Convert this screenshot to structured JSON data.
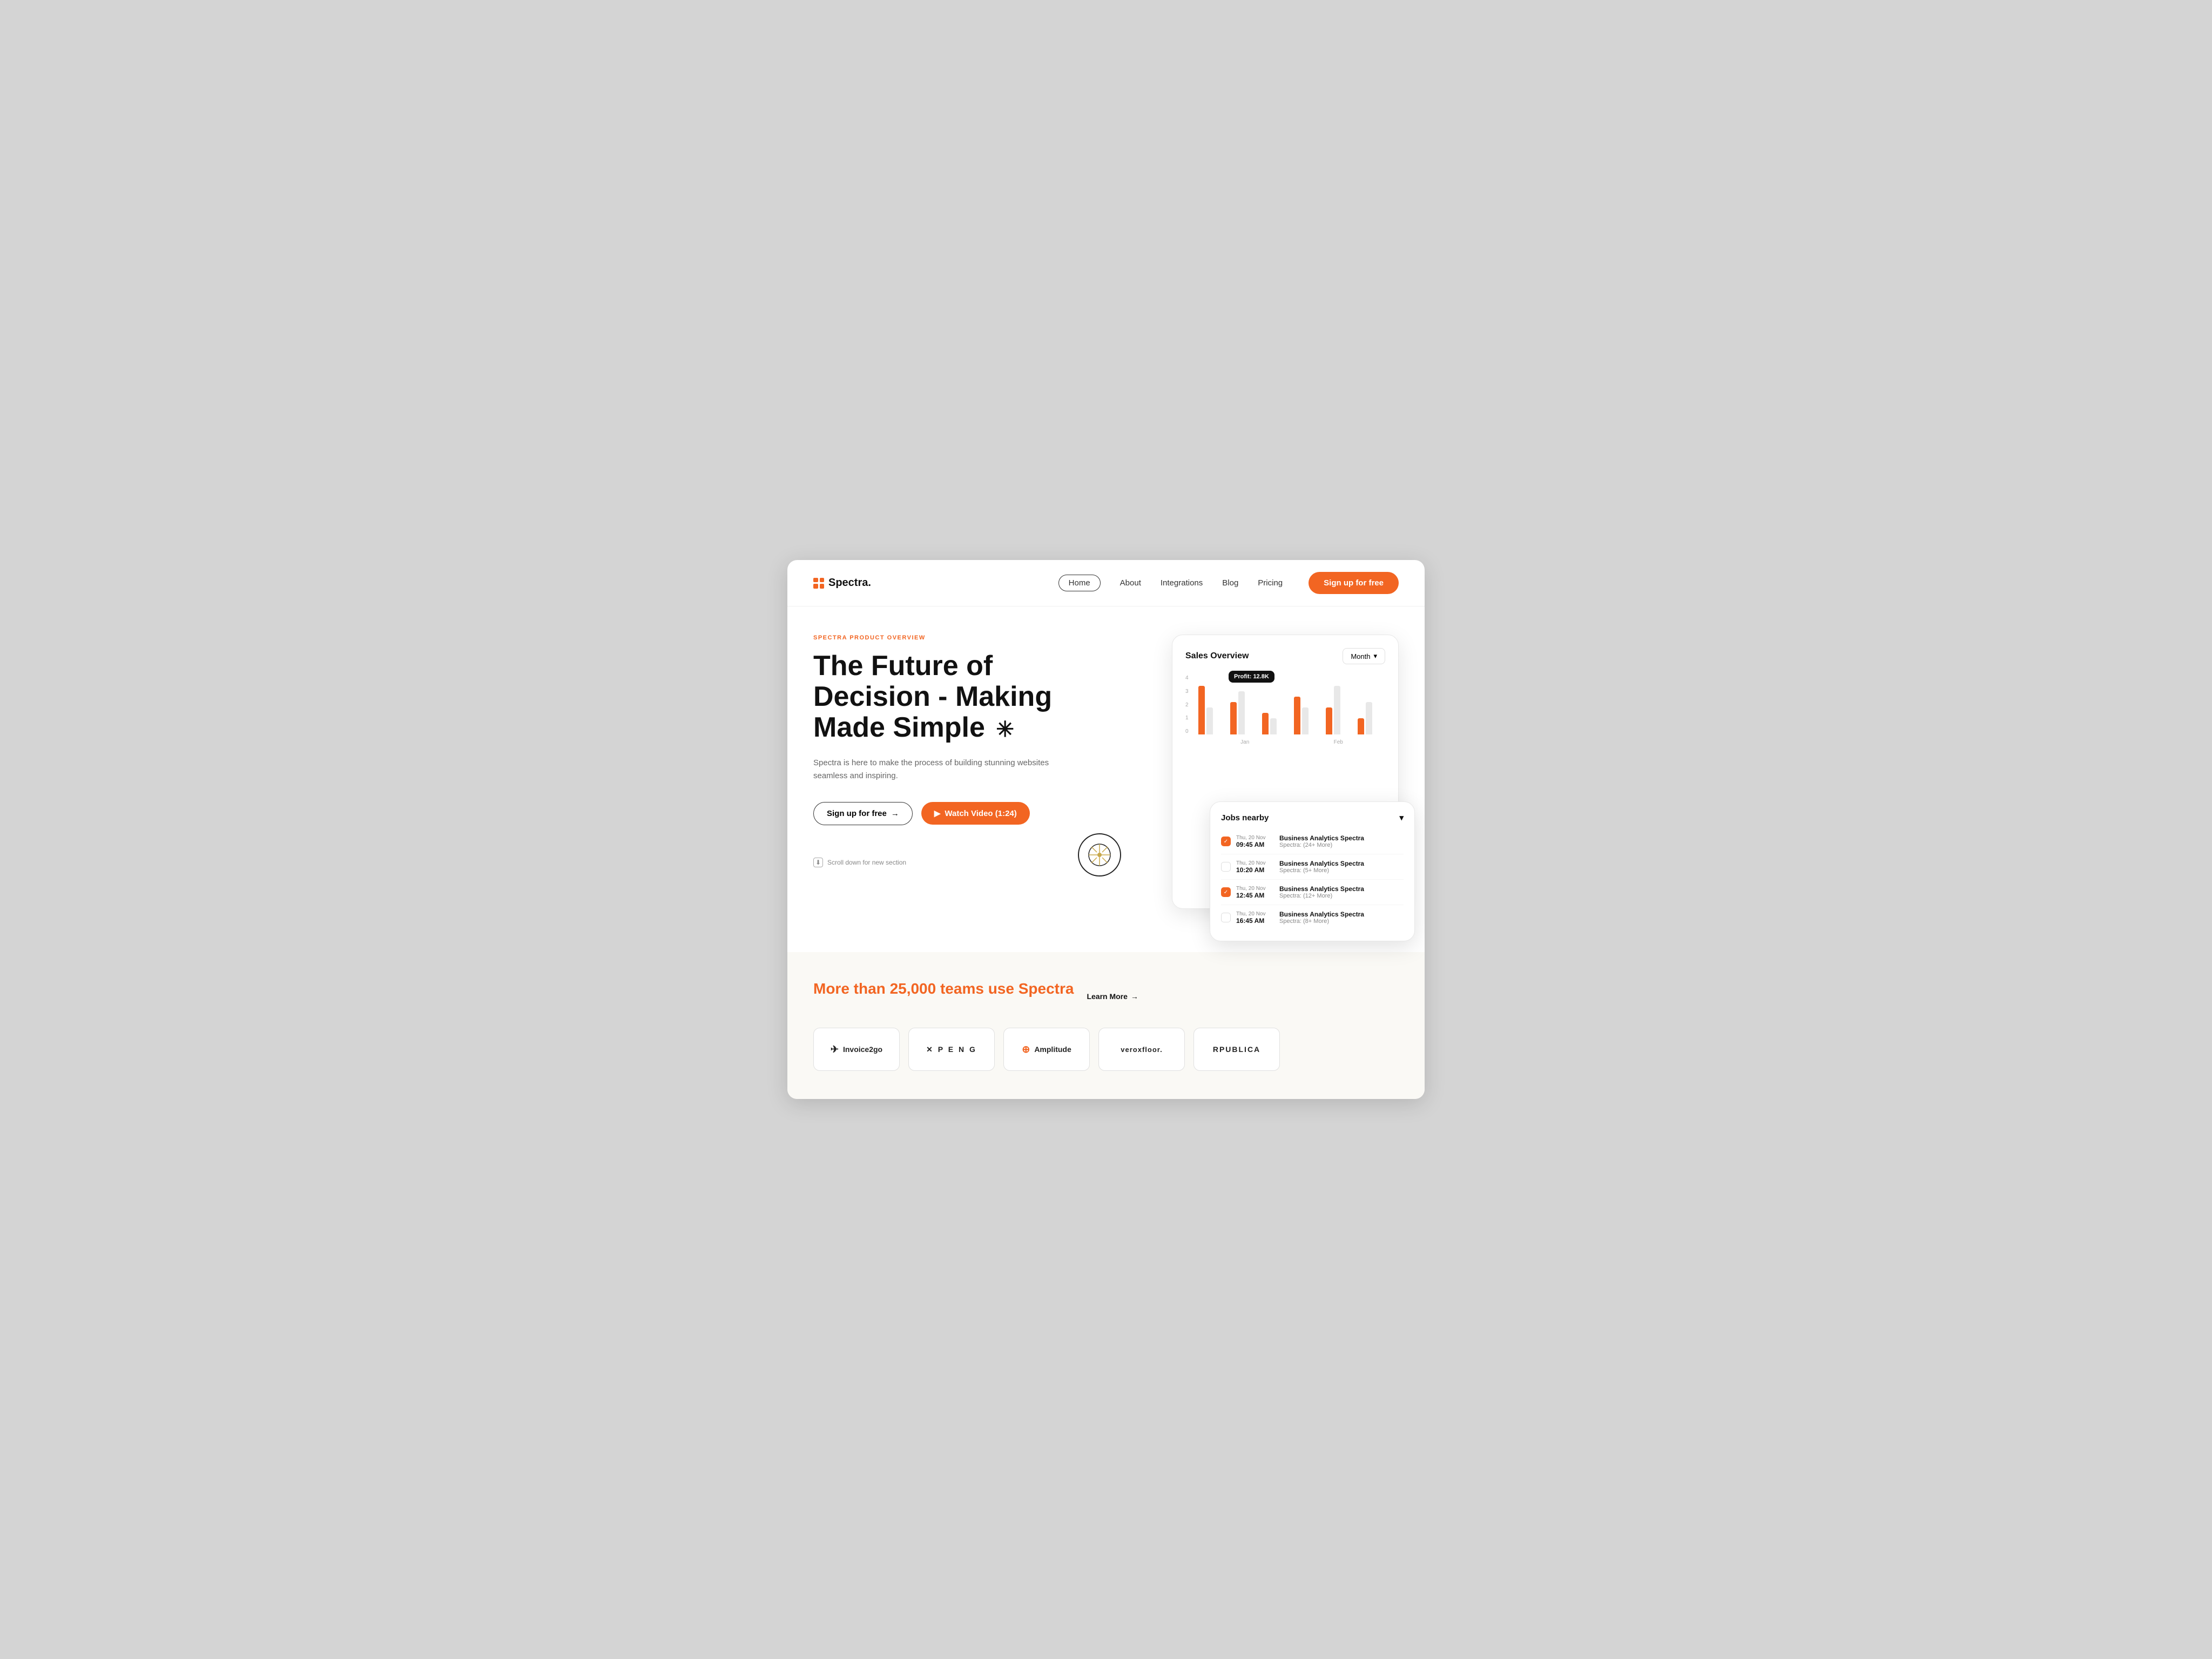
{
  "brand": {
    "name": "Spectra.",
    "logo_color": "#f26522"
  },
  "nav": {
    "links": [
      {
        "label": "Home",
        "active": true
      },
      {
        "label": "About",
        "active": false
      },
      {
        "label": "Integrations",
        "active": false
      },
      {
        "label": "Blog",
        "active": false
      },
      {
        "label": "Pricing",
        "active": false
      }
    ],
    "cta": "Sign up for free"
  },
  "hero": {
    "tag": "SPECTRA PRODUCT OVERVIEW",
    "title_line1": "The Future of",
    "title_line2": "Decision - Making",
    "title_line3": "Made Simple",
    "subtitle": "Spectra is here to make the process of building stunning websites seamless and inspiring.",
    "btn_signup": "Sign up for free",
    "btn_video": "Watch Video (1:24)",
    "scroll_text": "Scroll down for new section"
  },
  "dashboard": {
    "title": "Sales Overview",
    "period_label": "Month",
    "profit_tooltip": "Profit: 12.8K",
    "y_labels": [
      "4",
      "3",
      "2",
      "1",
      "0"
    ],
    "x_labels": [
      "Jan",
      "Feb"
    ],
    "bars": [
      {
        "orange": 90,
        "gray": 50
      },
      {
        "orange": 60,
        "gray": 80
      },
      {
        "orange": 40,
        "gray": 30
      },
      {
        "orange": 70,
        "gray": 50
      },
      {
        "orange": 50,
        "gray": 90
      },
      {
        "orange": 30,
        "gray": 60
      }
    ]
  },
  "jobs": {
    "title": "Jobs nearby",
    "items": [
      {
        "date": "Thu, 20 Nov",
        "time": "09:45 AM",
        "title": "Business Analytics Spectra",
        "subtitle": "Spectra: (24+ More)",
        "checked": true
      },
      {
        "date": "Thu, 20 Nov",
        "time": "10:20 AM",
        "title": "Business Analytics Spectra",
        "subtitle": "Spectra: (5+ More)",
        "checked": false
      },
      {
        "date": "Thu, 20 Nov",
        "time": "12:45 AM",
        "title": "Business Analytics Spectra",
        "subtitle": "Spectra: (12+ More)",
        "checked": true
      },
      {
        "date": "Thu, 20 Nov",
        "time": "16:45 AM",
        "title": "Business Analytics Spectra",
        "subtitle": "Spectra: (8+ More)",
        "checked": false
      }
    ]
  },
  "social_proof": {
    "text_before": "More than",
    "highlight": "25,000",
    "text_after": "teams use Spectra",
    "learn_more": "Learn More",
    "logos": [
      {
        "name": "Invoice2go",
        "icon": "✈"
      },
      {
        "name": "✕ P E N G",
        "icon": ""
      },
      {
        "name": "Amplitude",
        "icon": "⊕"
      },
      {
        "name": "veroxfloor.",
        "icon": ""
      },
      {
        "name": "RPUBLICA",
        "icon": ""
      }
    ]
  }
}
